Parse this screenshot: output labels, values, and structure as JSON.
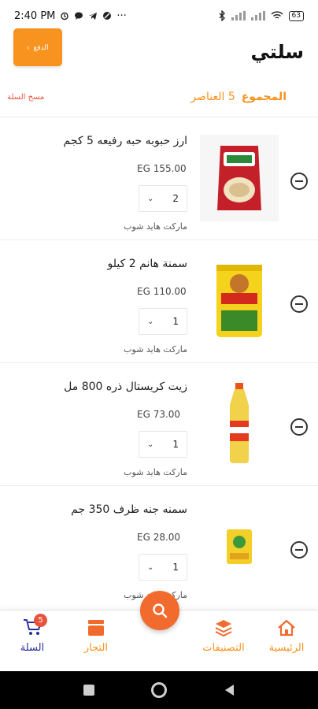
{
  "status_bar": {
    "time": "2:40 PM",
    "battery": "63"
  },
  "header": {
    "title": "سلتي",
    "pay_label": "الدفع"
  },
  "summary": {
    "total_label": "المجموع",
    "count_text": "5 العناصر",
    "clear_label": "مسح السلة"
  },
  "items": [
    {
      "name": "ارز حبوبه حبه رفيعه 5 كجم",
      "price": "EG 155.00",
      "qty": "2",
      "store": "ماركت هايد شوب",
      "image": "rice-bag"
    },
    {
      "name": "سمنة هانم 2 كيلو",
      "price": "EG 110.00",
      "qty": "1",
      "store": "ماركت هايد شوب",
      "image": "ghee-tin"
    },
    {
      "name": "زيت كريستال ذره 800 مل",
      "price": "EG 73.00",
      "qty": "1",
      "store": "ماركت هايد شوب",
      "image": "oil-bottle"
    },
    {
      "name": "سمنه جنه ظرف 350 جم",
      "price": "EG 28.00",
      "qty": "1",
      "store": "ماركت هايد شوب",
      "image": "ghee-pouch"
    }
  ],
  "bottom_nav": {
    "home": "الرئيسية",
    "categories": "التصنيفات",
    "merchants": "التجار",
    "cart": "السلة",
    "cart_count": "5"
  },
  "colors": {
    "accent": "#f7931e",
    "active": "#2a2f9e",
    "danger": "#e8533c"
  }
}
